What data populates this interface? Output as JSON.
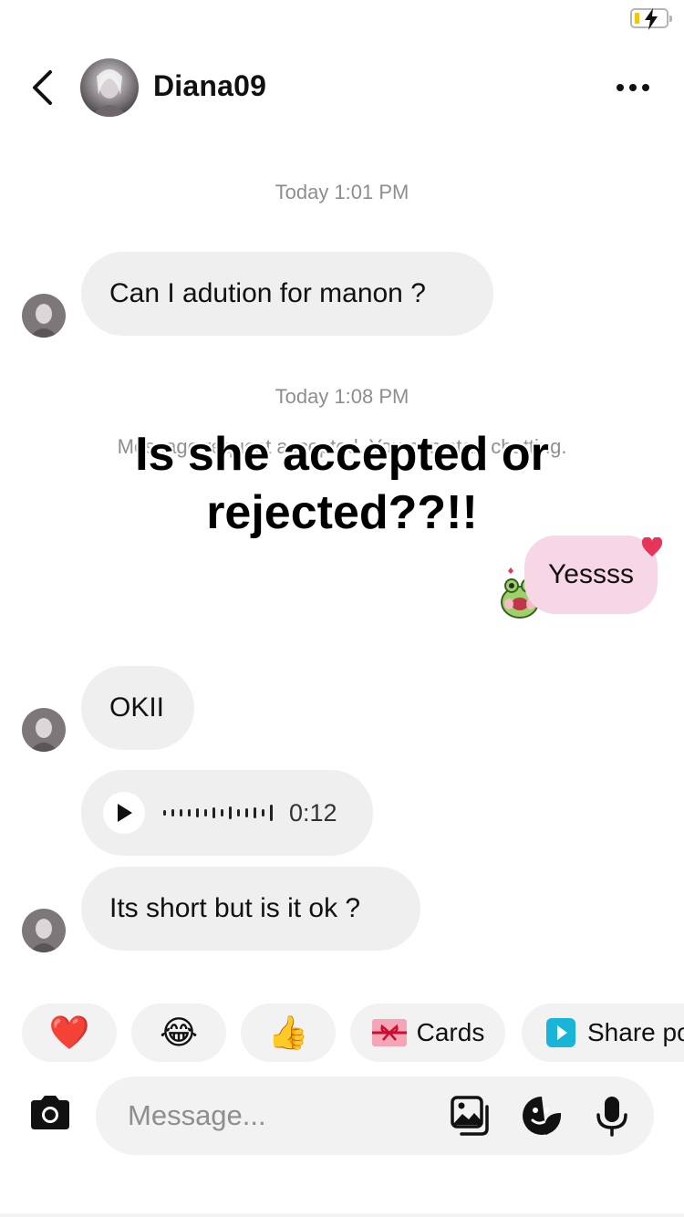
{
  "header": {
    "username": "Diana09"
  },
  "messages": {
    "timestamp_1": "Today 1:01 PM",
    "msg_1": "Can I adution for  manon ?",
    "timestamp_2": "Today 1:08 PM",
    "system_message": "Message request accepted. You can start chatting.",
    "overlay_caption": "Is she accepted or rejected??!!",
    "sent_reply": "Yessss",
    "msg_2": "OKII",
    "voice_duration": "0:12",
    "msg_3": "Its short but is it ok ?"
  },
  "quick_reactions": {
    "heart": "❤️",
    "laugh": "😂",
    "thumbs_up": "👍",
    "cards_label": "Cards",
    "share_label": "Share po"
  },
  "composer": {
    "placeholder": "Message..."
  },
  "icons": [
    "battery-icon",
    "back-icon",
    "more-icon",
    "play-icon",
    "camera-icon",
    "gallery-icon",
    "sticker-icon",
    "microphone-icon"
  ],
  "colors": {
    "received_bubble": "#efefef",
    "sent_bubble": "#f7d6e6",
    "timestamp": "#8e8e8e",
    "accent_heart": "#e8335a"
  }
}
